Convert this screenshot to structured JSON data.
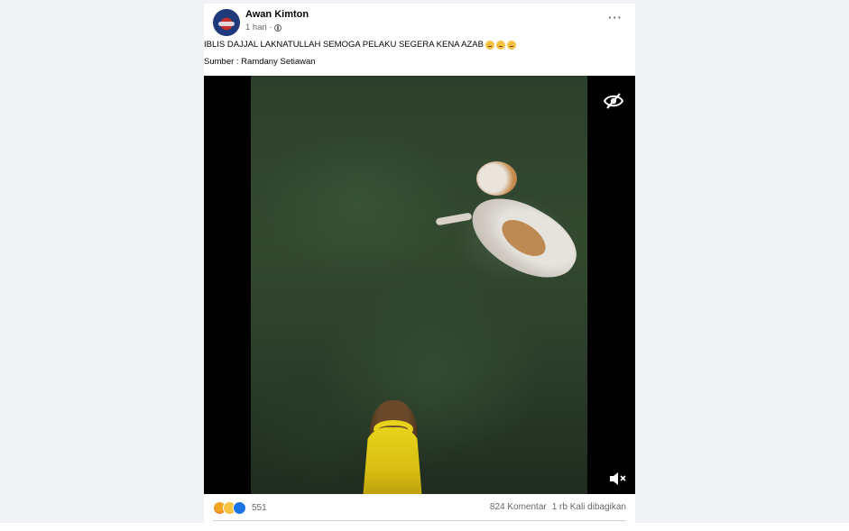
{
  "post": {
    "author": "Awan Kimton",
    "time": "1 hari · ",
    "caption": "IBLIS DAJJAL LAKNATULLAH SEMOGA PELAKU SEGERA KENA AZAB",
    "caption_emojis": [
      "angry",
      "angry",
      "angry"
    ],
    "source": "Sumber : Ramdany Setiawan",
    "more_label": "···"
  },
  "video": {
    "icons": [
      "eye-slash-icon",
      "mute-icon"
    ]
  },
  "footer": {
    "reaction_icons": [
      "angry-reaction",
      "sad-reaction",
      "care-reaction"
    ],
    "reaction_count": "551",
    "comments": "824 Komentar",
    "shares": "1 rb Kali dibagikan"
  },
  "colors": {
    "feed_background": "#f0f2f5",
    "text_primary": "#050505",
    "text_secondary": "#65676b"
  }
}
